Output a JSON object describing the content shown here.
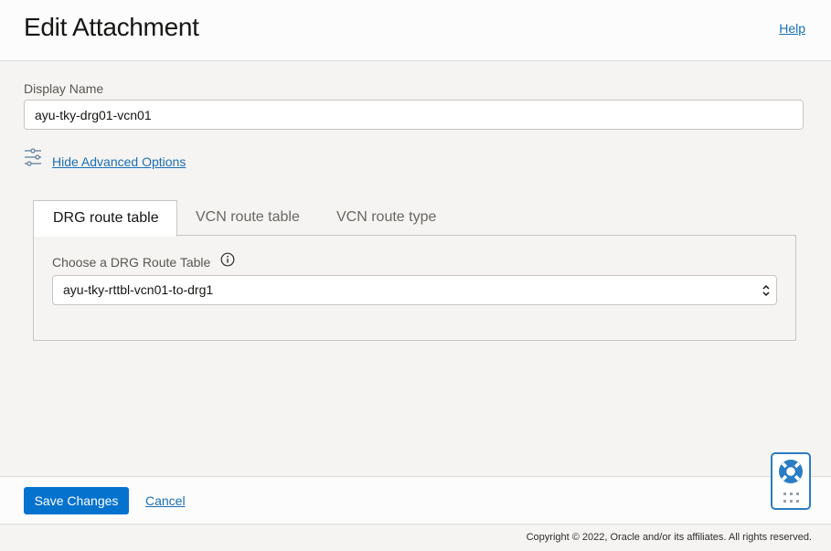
{
  "header": {
    "title": "Edit Attachment",
    "help_label": "Help"
  },
  "form": {
    "display_name_label": "Display Name",
    "display_name_value": "ayu-tky-drg01-vcn01",
    "advanced_toggle_label": "Hide Advanced Options",
    "advanced_icon": "sliders-icon"
  },
  "tabs": [
    {
      "label": "DRG route table",
      "active": true
    },
    {
      "label": "VCN route table",
      "active": false
    },
    {
      "label": "VCN route type",
      "active": false
    }
  ],
  "drg_panel": {
    "label": "Choose a DRG Route Table",
    "info_icon": "info-icon",
    "selected": "ayu-tky-rttbl-vcn01-to-drg1"
  },
  "footer": {
    "save_label": "Save Changes",
    "cancel_label": "Cancel",
    "copyright": "Copyright © 2022, Oracle and/or its affiliates. All rights reserved."
  },
  "help_widget": {
    "icon": "lifebuoy-icon"
  },
  "colors": {
    "primary": "#0572ce",
    "link": "#1a6fb3",
    "background": "#f5f4f2"
  }
}
